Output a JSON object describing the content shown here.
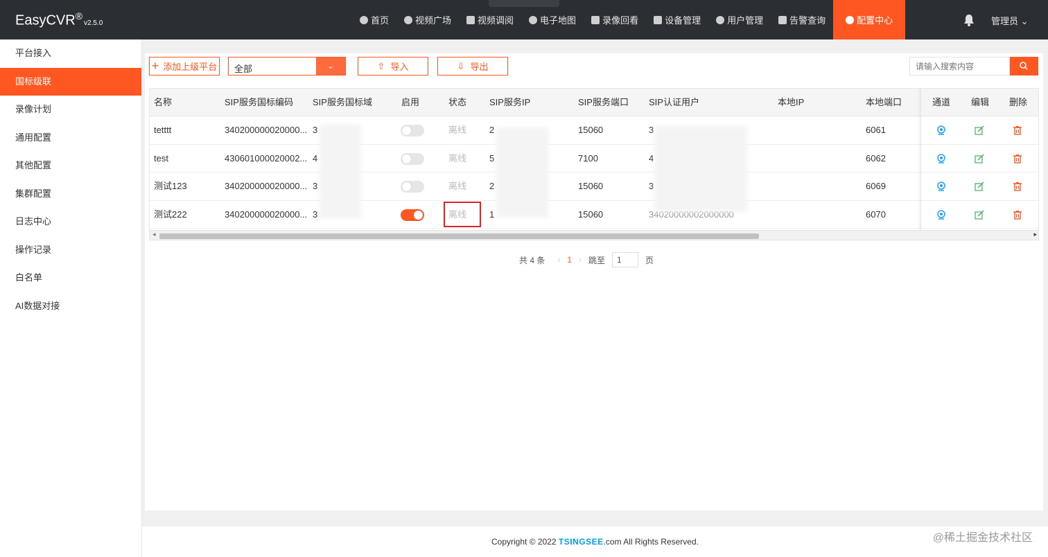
{
  "brand": {
    "name": "EasyCVR",
    "reg": "®",
    "version": "v2.5.0"
  },
  "nav": [
    {
      "label": "首页",
      "icon": "dashboard-icon"
    },
    {
      "label": "视频广场",
      "icon": "play-circle-icon"
    },
    {
      "label": "视频调阅",
      "icon": "layout-icon"
    },
    {
      "label": "电子地图",
      "icon": "map-pin-icon"
    },
    {
      "label": "录像回看",
      "icon": "video-camera-icon"
    },
    {
      "label": "设备管理",
      "icon": "device-icon"
    },
    {
      "label": "用户管理",
      "icon": "user-icon"
    },
    {
      "label": "告警查询",
      "icon": "alarm-icon"
    },
    {
      "label": "配置中心",
      "icon": "gear-icon"
    }
  ],
  "admin": "管理员",
  "sidebar": [
    {
      "label": "平台接入"
    },
    {
      "label": "国标级联"
    },
    {
      "label": "录像计划"
    },
    {
      "label": "通用配置"
    },
    {
      "label": "其他配置"
    },
    {
      "label": "集群配置"
    },
    {
      "label": "日志中心"
    },
    {
      "label": "操作记录"
    },
    {
      "label": "白名单"
    },
    {
      "label": "AI数据对接"
    }
  ],
  "toolbar": {
    "add_label": "添加上级平台",
    "select_value": "全部",
    "import_label": "导入",
    "export_label": "导出",
    "search_placeholder": "请输入搜索内容"
  },
  "table": {
    "headers": [
      "名称",
      "SIP服务国标编码",
      "SIP服务国标域",
      "启用",
      "状态",
      "SIP服务IP",
      "SIP服务端口",
      "SIP认证用户",
      "本地IP",
      "本地端口",
      "通道",
      "编辑",
      "删除"
    ],
    "rows": [
      {
        "name": "tetttt",
        "code": "340200000020000...",
        "domain": "3",
        "enabled": false,
        "status": "离线",
        "ip": "2",
        "port": "15060",
        "user": "3",
        "local_ip": "",
        "local_port": "6061"
      },
      {
        "name": "test",
        "code": "430601000020002...",
        "domain": "4",
        "enabled": false,
        "status": "离线",
        "ip": "5",
        "port": "7100",
        "user": "4",
        "local_ip": "",
        "local_port": "6062"
      },
      {
        "name": "测试123",
        "code": "340200000020000...",
        "domain": "3",
        "enabled": false,
        "status": "离线",
        "ip": "2",
        "port": "15060",
        "user": "3",
        "local_ip": "",
        "local_port": "6069"
      },
      {
        "name": "测试222",
        "code": "340200000020000...",
        "domain": "3",
        "enabled": true,
        "status": "离线",
        "ip": "1",
        "port": "15060",
        "user": "34020000002000000",
        "local_ip": "",
        "local_port": "6070"
      }
    ]
  },
  "pager": {
    "total": "共 4 条",
    "current": "1",
    "jump_label": "跳至",
    "jump_value": "1",
    "page_suffix": "页"
  },
  "footer": {
    "prefix": "Copyright © 2022 ",
    "brand": "TSINGSEE",
    "suffix": ".com All Rights Reserved."
  },
  "watermark": "@稀土掘金技术社区",
  "colors": {
    "accent": "#ff5722",
    "topbar": "#2b2f33",
    "channel_icon": "#1e9fff",
    "edit_icon": "#5fb878",
    "delete_icon": "#ff5722"
  }
}
